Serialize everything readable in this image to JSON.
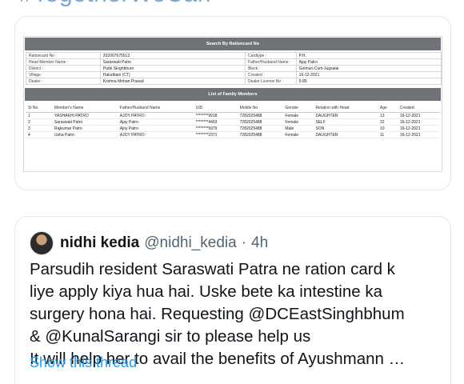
{
  "hashtag_top": "#TogetherWeCan",
  "ration_card": {
    "search_title": "Search By Rationcard No",
    "info_rows": [
      {
        "l1": "Rationcard No :",
        "v1": "202007675513",
        "l2": "Cardtype :",
        "v2": "P.H."
      },
      {
        "l1": "Head Member Name :",
        "v1": "Saraswati Patro",
        "l2": "Father/Husband Name :",
        "v2": "Ajay Patro"
      },
      {
        "l1": "District :",
        "v1": "Purbi Singhbhum",
        "l2": "Block :",
        "v2": "Golmuri-Cum-Jugsalai"
      },
      {
        "l1": "Village :",
        "v1": "Haludbani (CT)",
        "l2": "Created :",
        "v2": "16-12-2021"
      },
      {
        "l1": "Dealer :",
        "v1": "Krishna Mohan Prasad",
        "l2": "Dealer License No :",
        "v2": "5-85"
      }
    ],
    "members_title": "List of Family Members",
    "columns": [
      "Sl No.",
      "Member's Name",
      "Father/Husband Name",
      "UID",
      "Mobile No",
      "Gender",
      "Relation with Head",
      "Age",
      "Created"
    ],
    "members": [
      {
        "sl": "1",
        "name": "YASHAKHI PATRO",
        "father": "AJOY PATRO",
        "uid": "********9918",
        "mobile": "7282025488",
        "gender": "Female",
        "relation": "DAUGHTER",
        "age": "13",
        "created": "16-12-2021"
      },
      {
        "sl": "2",
        "name": "Saraswati Patro",
        "father": "Ajay Patro",
        "uid": "********4493",
        "mobile": "7282025488",
        "gender": "Female",
        "relation": "SELF",
        "age": "32",
        "created": "16-12-2021"
      },
      {
        "sl": "3",
        "name": "Rajkumar Patro",
        "father": "Ajoy Patro",
        "uid": "********5979",
        "mobile": "7282025488",
        "gender": "Male",
        "relation": "SON",
        "age": "10",
        "created": "16-12-2021"
      },
      {
        "sl": "4",
        "name": "Usha Patro",
        "father": "AJOY PATRO",
        "uid": "********2371",
        "mobile": "7282025488",
        "gender": "Female",
        "relation": "DAUGHTER",
        "age": "11",
        "created": "16-12-2021"
      }
    ]
  },
  "tweet": {
    "display_name": "nidhi kedia",
    "handle": "@nidhi_kedia",
    "separator": "·",
    "time": "4h",
    "lines": [
      "Parsudih resident Saraswati Patra ne ration card k",
      "liye apply kiya hua hai. Uske bete ka intestine ka",
      "surgery hona hai. Requesting @DCEastSinghbhum",
      "& @KunalSarangi sir to please help us",
      "It will help her to avail the benefits of Ayushmann …"
    ],
    "show_thread": "Show this thread"
  },
  "colors": {
    "header_bar": "#6f7377",
    "link": "#1d9bf0",
    "muted": "#536471"
  }
}
